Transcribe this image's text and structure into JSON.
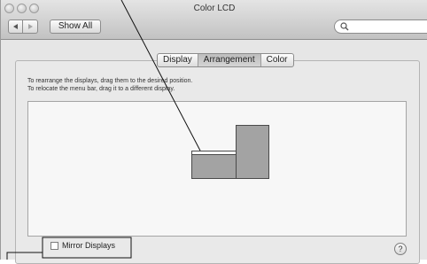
{
  "window": {
    "title": "Color LCD"
  },
  "toolbar": {
    "show_all_label": "Show All",
    "search_placeholder": ""
  },
  "tabs": [
    {
      "label": "Display",
      "active": false
    },
    {
      "label": "Arrangement",
      "active": true
    },
    {
      "label": "Color",
      "active": false
    }
  ],
  "instructions": [
    "To rearrange the displays, drag them to the desired position.",
    "To relocate the menu bar, drag it to a different display."
  ],
  "mirror": {
    "label": "Mirror Displays",
    "checked": false
  },
  "help": {
    "glyph": "?"
  },
  "colors": {
    "display_fill": "#a3a3a3",
    "arrangement_bg": "#f7f7f7",
    "panel_bg": "#e9e9e9"
  }
}
